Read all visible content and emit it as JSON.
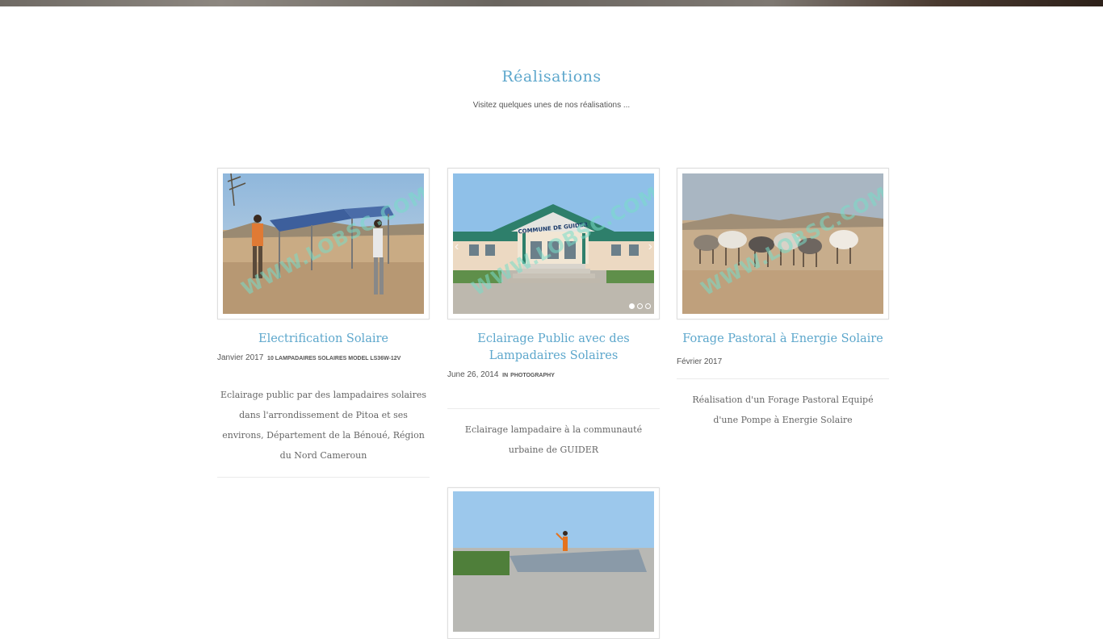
{
  "section": {
    "title": "Réalisations",
    "subtitle": "Visitez quelques unes de nos réalisations ..."
  },
  "watermark": "WWW.LOBSC.COM",
  "cards": [
    {
      "title": "Electrification Solaire",
      "date": "Janvier 2017",
      "category": "10 LAMPADAIRES SOLAIRES MODEL LS36W-12V",
      "description": "Eclairage public par des lampadaires solaires dans l'arrondissement de Pitoa et ses environs, Département de la Bénoué, Région du Nord Cameroun",
      "image_subject": "solar-panel-installation"
    },
    {
      "title": "Eclairage Public avec des Lampadaires Solaires",
      "date": "June 26, 2014",
      "category_prefix": "IN",
      "category": "PHOTOGRAPHY",
      "description": "Eclairage lampadaire à la communauté urbaine de GUIDER",
      "image_subject": "commune-de-guider-building",
      "sign_text": "COMMUNE DE GUIDER",
      "slider_dots": 3,
      "slider_active": 1
    },
    {
      "title": "Forage Pastoral à Energie Solaire",
      "date": "Février 2017",
      "category": "",
      "description": "Réalisation d'un Forage Pastoral Equipé d'une Pompe à Energie Solaire",
      "image_subject": "cattle-at-water-point"
    },
    {
      "title": "",
      "image_subject": "worker-on-roof-solar"
    }
  ]
}
